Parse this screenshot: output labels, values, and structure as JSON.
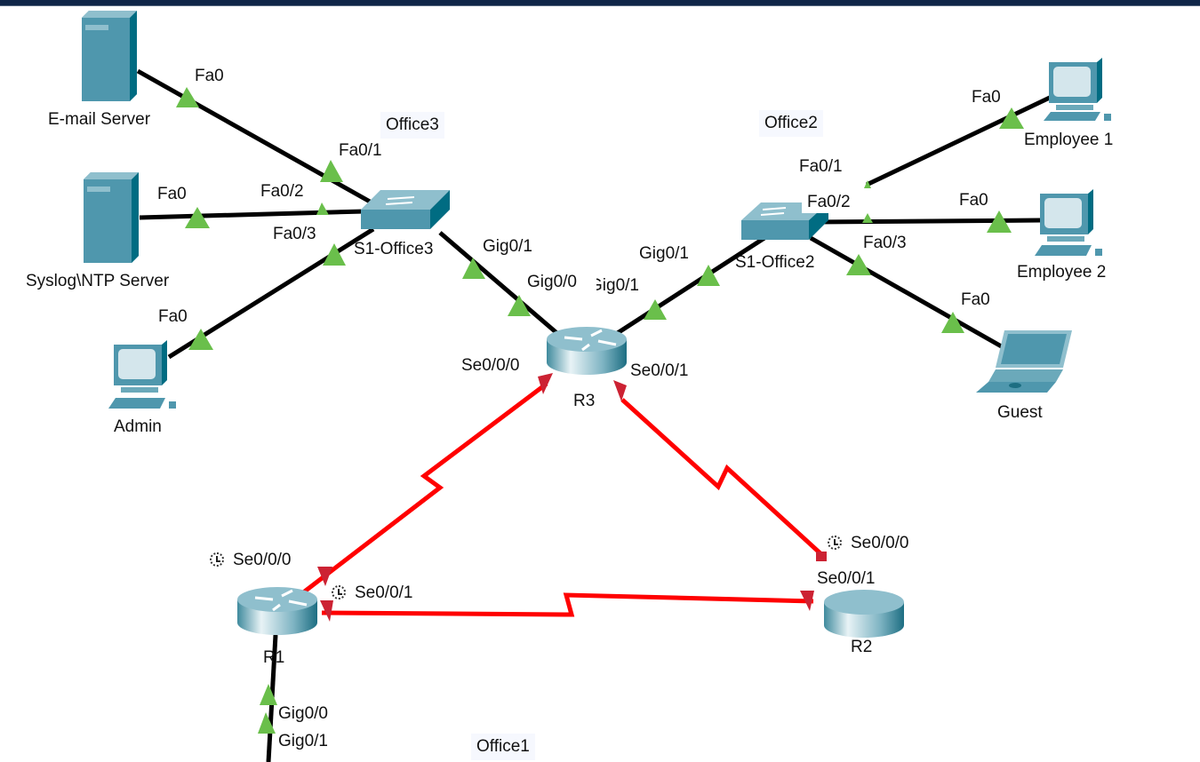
{
  "colors": {
    "ethernet_link": "#000000",
    "serial_link": "#ff0000",
    "port_up": "#6abf4b",
    "serial_port": "#cc2233",
    "device_body": "#4f97ad",
    "device_dark": "#006c82",
    "device_light": "#8fbfcd",
    "header_bar": "#0f2547"
  },
  "areas": {
    "office1": "Office1",
    "office2": "Office2",
    "office3": "Office3"
  },
  "devices": {
    "email_server": "E-mail Server",
    "syslog_server": "Syslog\\NTP Server",
    "admin": "Admin",
    "s1_office3": "S1-Office3",
    "s1_office2": "S1-Office2",
    "r3": "R3",
    "r1": "R1",
    "r2": "R2",
    "employee1": "Employee 1",
    "employee2": "Employee 2",
    "guest": "Guest"
  },
  "ports": {
    "email_fa0": "Fa0",
    "syslog_fa0": "Fa0",
    "admin_fa0": "Fa0",
    "s3_fa01": "Fa0/1",
    "s3_fa02": "Fa0/2",
    "s3_fa03": "Fa0/3",
    "s3_gig01": "Gig0/1",
    "r3_gig00": "Gig0/0",
    "r3_gig01": "Gig0/1",
    "s2_gig01": "Gig0/1",
    "s2_fa01": "Fa0/1",
    "s2_fa02": "Fa0/2",
    "s2_fa03": "Fa0/3",
    "emp1_fa0": "Fa0",
    "emp2_fa0": "Fa0",
    "guest_fa0": "Fa0",
    "r3_se000": "Se0/0/0",
    "r3_se001": "Se0/0/1",
    "r1_se000": "Se0/0/0",
    "r1_se001": "Se0/0/1",
    "r2_se000": "Se0/0/0",
    "r2_se001": "Se0/0/1",
    "r1_gig00": "Gig0/0",
    "r1_gig01": "Gig0/1"
  }
}
